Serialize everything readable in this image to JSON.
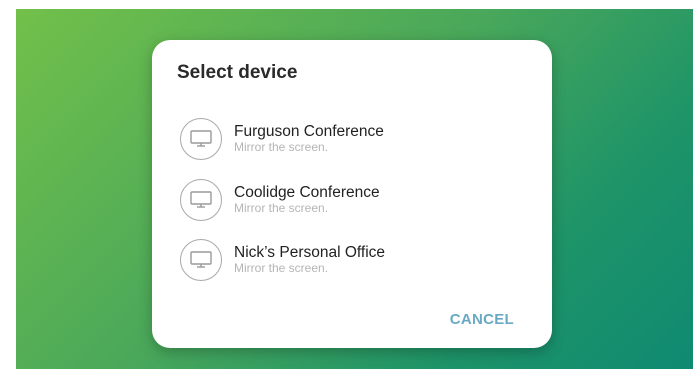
{
  "dialog": {
    "title": "Select device",
    "devices": [
      {
        "name": "Furguson Conference",
        "subtitle": "Mirror the screen.",
        "icon": "monitor-icon"
      },
      {
        "name": "Coolidge Conference",
        "subtitle": "Mirror the screen.",
        "icon": "monitor-icon"
      },
      {
        "name": "Nick’s Personal Office",
        "subtitle": "Mirror the screen.",
        "icon": "monitor-icon"
      }
    ],
    "cancel_label": "CANCEL"
  },
  "colors": {
    "accent": "#6aa9c4",
    "background_gradient_start": "#72c04a",
    "background_gradient_end": "#0f8a72"
  }
}
